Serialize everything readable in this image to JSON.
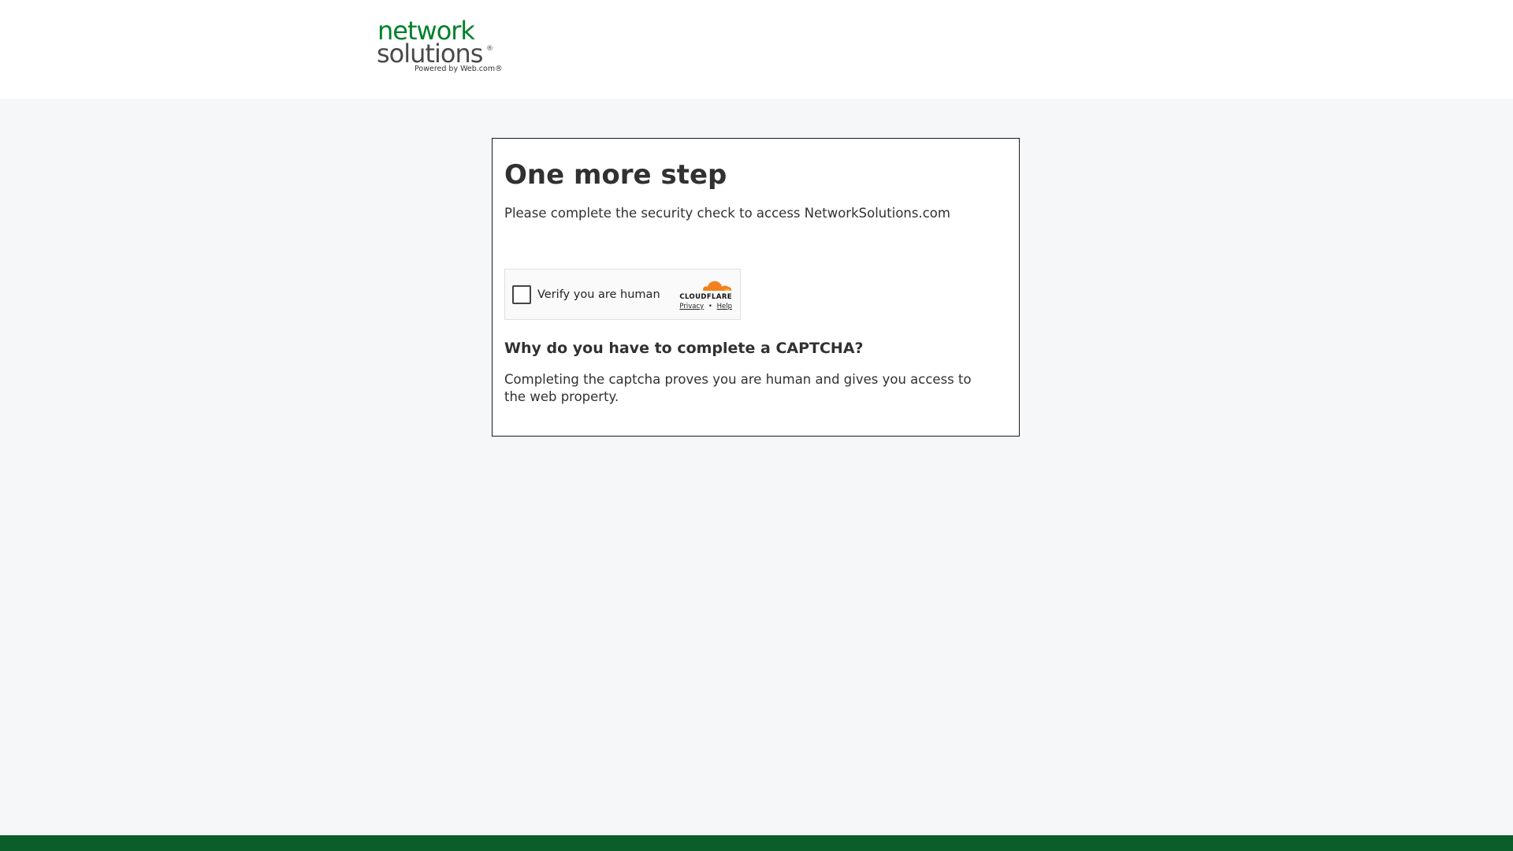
{
  "header": {
    "logo": {
      "line1": "network",
      "line2": "solutions",
      "registered": "®",
      "tagline": "Powered by Web.com®"
    }
  },
  "card": {
    "title": "One more step",
    "subtitle": "Please complete the security check to access NetworkSolutions.com",
    "captcha": {
      "label": "Verify you are human",
      "brand": "CLOUDFLARE",
      "privacy_link": "Privacy",
      "separator": "•",
      "help_link": "Help",
      "checked": false
    },
    "why_heading": "Why do you have to complete a CAPTCHA?",
    "why_text": "Completing the captcha proves you are human and gives you access to the web property."
  },
  "colors": {
    "brand_green": "#00802b",
    "footer_green": "#0b5d2a",
    "cloudflare_orange": "#f38020",
    "page_background": "#f6f7f8"
  }
}
